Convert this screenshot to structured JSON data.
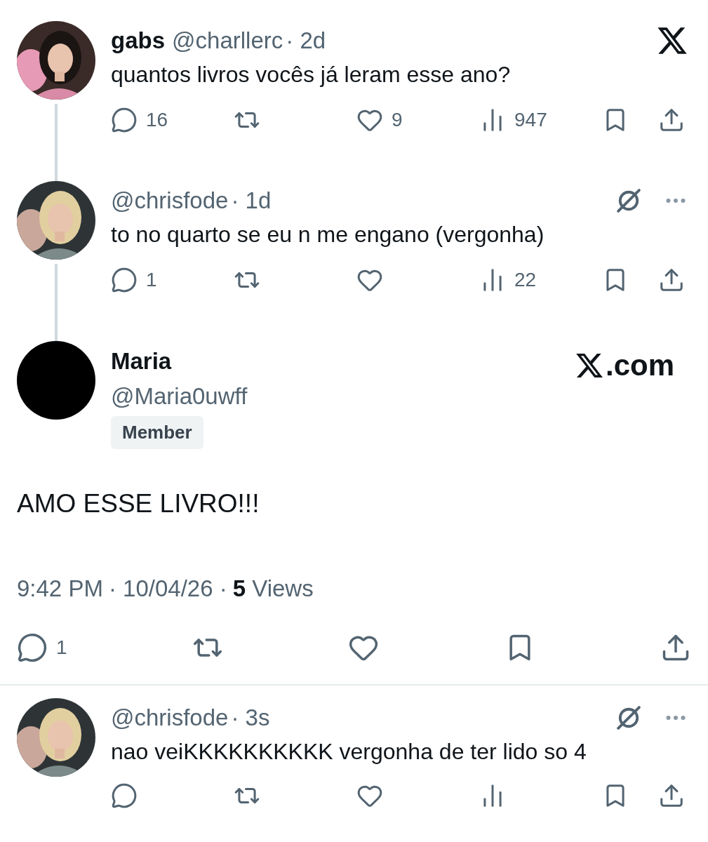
{
  "thread": [
    {
      "name": "gabs",
      "handle": "@charllerc",
      "time": "· 2d",
      "brand_logo": true,
      "grok_menu": false,
      "connected": true,
      "text": "quantos livros vocês já leram esse ano?",
      "actions": [
        {
          "kind": "reply",
          "count": "16"
        },
        {
          "kind": "repost"
        },
        {
          "kind": "like",
          "count": "9"
        },
        {
          "kind": "views",
          "count": "947"
        },
        {
          "kind": "bookmark"
        },
        {
          "kind": "share"
        }
      ]
    },
    {
      "handle": "@chrisfode",
      "time": "· 1d",
      "brand_logo": false,
      "grok_menu": true,
      "connected": true,
      "text": "to no quarto se eu n me engano (vergonha)",
      "actions": [
        {
          "kind": "reply",
          "count": "1"
        },
        {
          "kind": "repost"
        },
        {
          "kind": "like"
        },
        {
          "kind": "views",
          "count": "22"
        },
        {
          "kind": "bookmark"
        },
        {
          "kind": "share"
        }
      ]
    }
  ],
  "main": {
    "avatar": {
      "kind": "blank"
    },
    "name": "Maria",
    "handle": "@Maria0uwff",
    "badge": "Member",
    "brand_suffix": ".com",
    "text": "AMO ESSE LIVRO!!!",
    "time": "9:42 PM",
    "date": "· 10/04/26 ·",
    "views": "5",
    "views_label": "Views",
    "actions": [
      {
        "kind": "reply",
        "count": "1"
      },
      {
        "kind": "repost"
      },
      {
        "kind": "like"
      },
      {
        "kind": "bookmark"
      },
      {
        "kind": "share"
      }
    ]
  },
  "replies": [
    {
      "handle": "@chrisfode",
      "time": "· 3s",
      "brand_logo": false,
      "grok_menu": true,
      "connected": false,
      "text": "nao veiKKKKKKKKKK vergonha de ter lido so 4",
      "actions": [
        {
          "kind": "reply"
        },
        {
          "kind": "repost"
        },
        {
          "kind": "like"
        },
        {
          "kind": "views"
        },
        {
          "kind": "bookmark"
        },
        {
          "kind": "share"
        }
      ]
    }
  ]
}
